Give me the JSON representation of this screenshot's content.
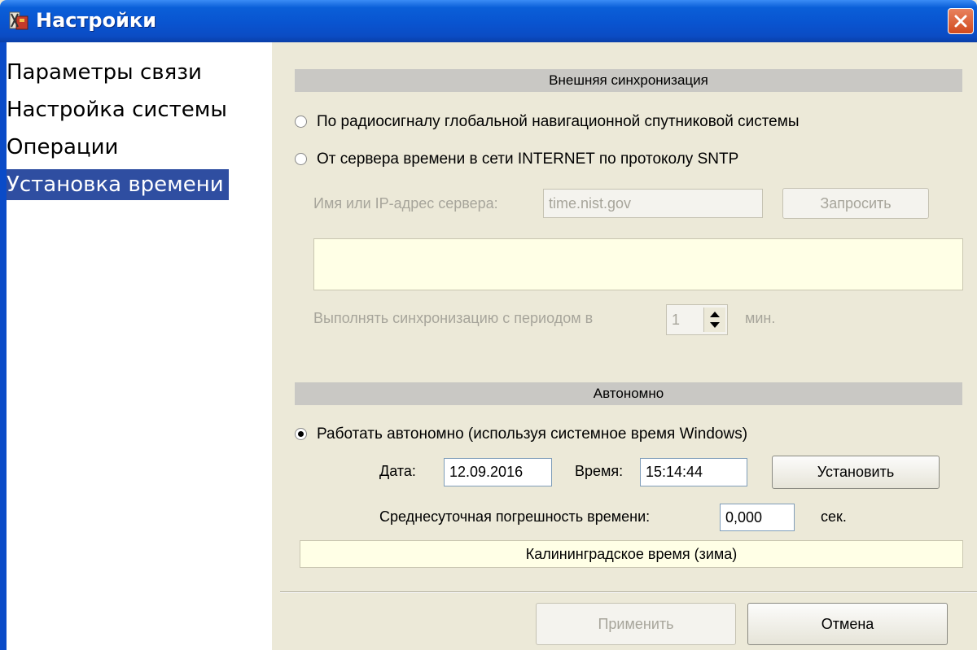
{
  "window": {
    "title": "Настройки",
    "icon": "settings-app-icon"
  },
  "sidebar": {
    "items": [
      {
        "label": "Параметры связи",
        "selected": false
      },
      {
        "label": "Настройка системы",
        "selected": false
      },
      {
        "label": "Операции",
        "selected": false
      },
      {
        "label": "Установка времени",
        "selected": true
      }
    ]
  },
  "external_sync": {
    "header": "Внешняя синхронизация",
    "radio_gnss": {
      "label": "По радиосигналу глобальной навигационной спутниковой системы",
      "checked": false
    },
    "radio_sntp": {
      "label": "От сервера времени в сети INTERNET по протоколу SNTP",
      "checked": false
    },
    "server_label": "Имя или IP-адрес сервера:",
    "server_value": "time.nist.gov",
    "request_button": "Запросить",
    "period_label": "Выполнять синхронизацию с периодом в",
    "period_value": "1",
    "period_unit": "мин."
  },
  "autonomous": {
    "header": "Автономно",
    "radio_auto": {
      "label": "Работать автономно (используя системное время Windows)",
      "checked": true
    },
    "date_label": "Дата:",
    "date_value": "12.09.2016",
    "time_label": "Время:",
    "time_value": "15:14:44",
    "set_button": "Установить",
    "error_label": "Среднесуточная погрешность времени:",
    "error_value": "0,000",
    "error_unit": "сек.",
    "timezone": "Калининградское время (зима)"
  },
  "footer": {
    "apply_button": "Применить",
    "cancel_button": "Отмена"
  },
  "colors": {
    "titlebar": "#0954d0",
    "selection": "#2f4ea1",
    "panel_bg": "#ece9d8",
    "header_bg": "#c9c8c4",
    "info_bg": "#ffffe6",
    "disabled_text": "#a7a59b"
  }
}
